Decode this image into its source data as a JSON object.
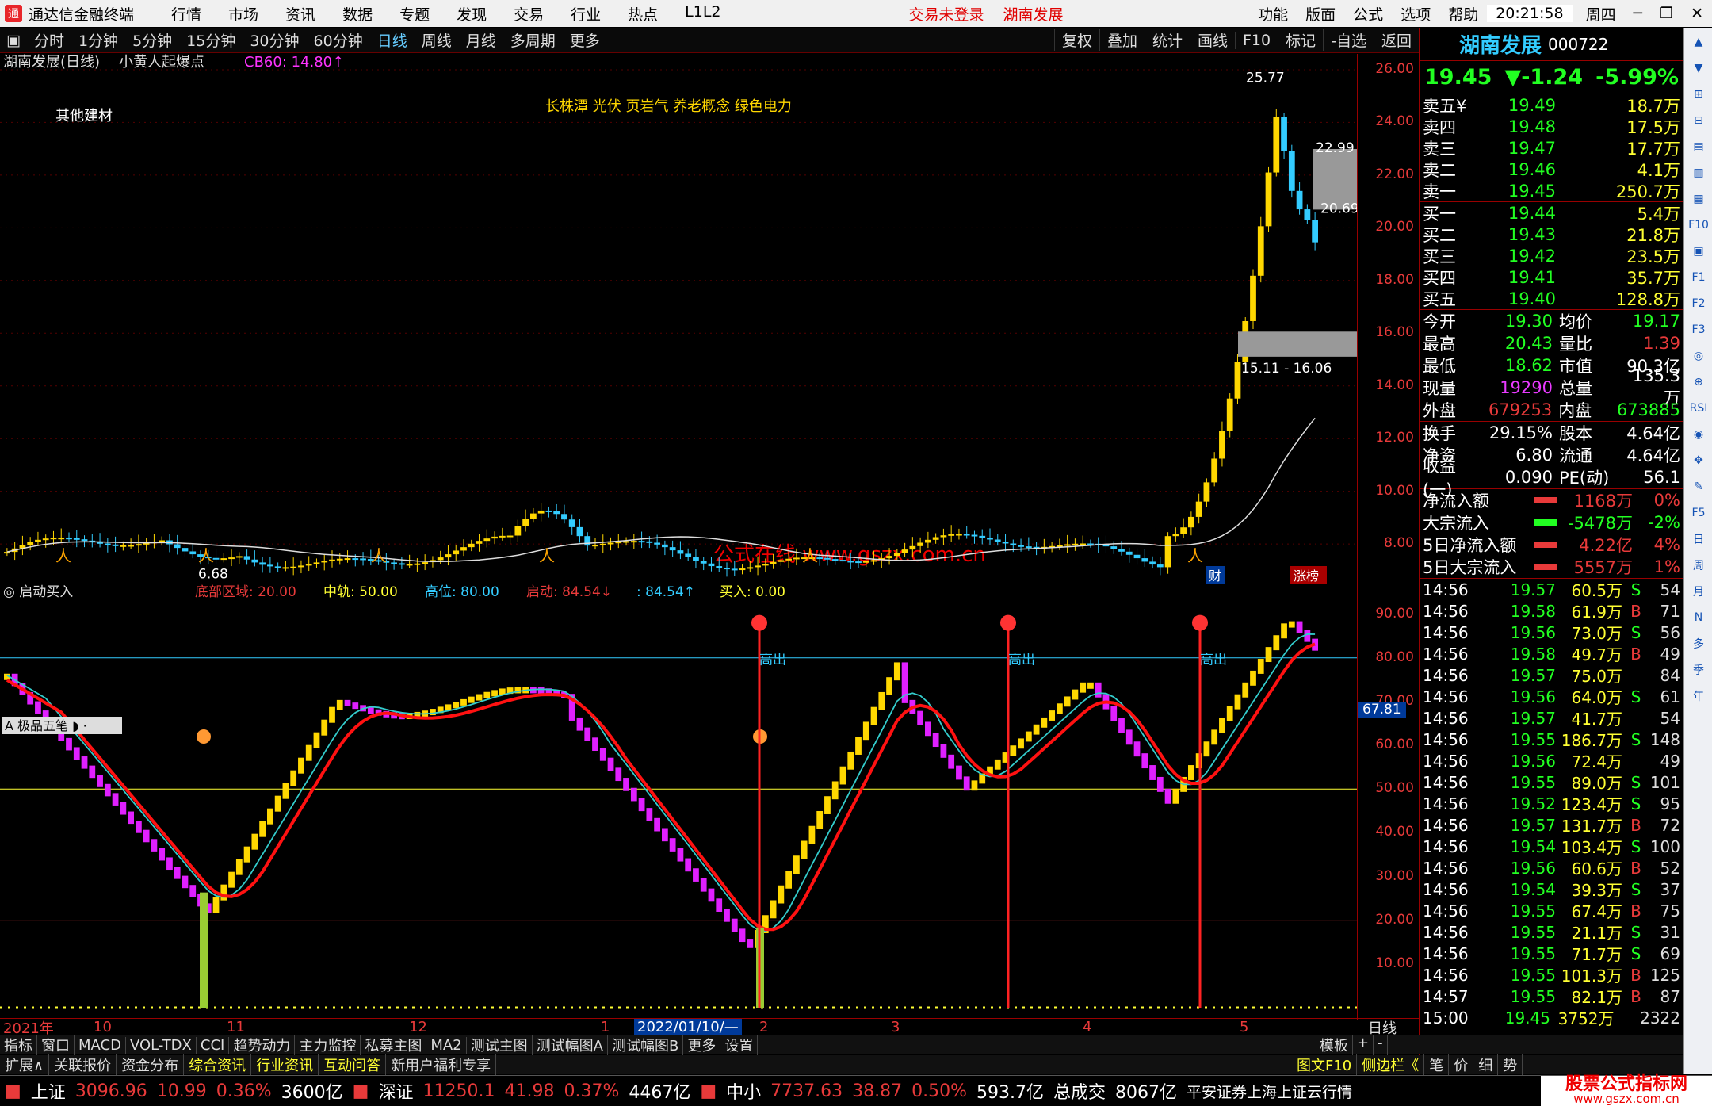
{
  "app": {
    "title": "通达信金融终端",
    "trade_status": "交易未登录",
    "stock_title": "湖南发展",
    "clock": "20:21:58",
    "weekday": "周四"
  },
  "menu": [
    "行情",
    "市场",
    "资讯",
    "数据",
    "专题",
    "发现",
    "交易",
    "行业",
    "热点",
    "L1L2"
  ],
  "menu_right": [
    "功能",
    "版面",
    "公式",
    "选项",
    "帮助"
  ],
  "periods": [
    "分时",
    "1分钟",
    "5分钟",
    "15分钟",
    "30分钟",
    "60分钟",
    "日线",
    "周线",
    "月线",
    "多周期",
    "更多"
  ],
  "active_period": "日线",
  "toolbar_right": [
    "复权",
    "叠加",
    "统计",
    "画线",
    "F10",
    "标记",
    "-自选",
    "返回"
  ],
  "price_header": {
    "name": "湖南发展(日线)",
    "formula": "小黄人起爆点",
    "cb": "CB60: 14.80↑"
  },
  "sector": "其他建材",
  "concepts": "长株潭 光伏 页岩气 养老概念 绿色电力",
  "watermark": "公式在线  www.gszx.com.cn",
  "price_ticks": [
    "26.00",
    "24.00",
    "22.00",
    "20.00",
    "18.00",
    "16.00",
    "14.00",
    "12.00",
    "10.00",
    "8.00"
  ],
  "price_labels": {
    "high": "25.77",
    "p1": "22.99",
    "p2": "20.69",
    "gap": "15.11 - 16.06",
    "low": "6.68"
  },
  "badges": [
    "财",
    "涨榜"
  ],
  "ind_header": {
    "name": "启动买入",
    "items": [
      {
        "k": "底部区域:",
        "v": "20.00",
        "c": "#e83a3a"
      },
      {
        "k": "中轨:",
        "v": "50.00",
        "c": "#ff3"
      },
      {
        "k": "高位:",
        "v": "80.00",
        "c": "#3cf"
      },
      {
        "k": "启动:",
        "v": "84.54↓",
        "c": "#e83a3a"
      },
      {
        "k": ":",
        "v": "84.54↑",
        "c": "#3cf"
      },
      {
        "k": "买入:",
        "v": "0.00",
        "c": "#ff3"
      }
    ]
  },
  "ind_ticks": [
    "90.00",
    "80.00",
    "70.00",
    "60.00",
    "50.00",
    "40.00",
    "30.00",
    "20.00",
    "10.00"
  ],
  "ind_value": "67.81",
  "gaochu": "高出",
  "tool_label": "极品五笔",
  "date_axis": [
    {
      "t": "2021年"
    },
    {
      "t": "10"
    },
    {
      "t": "11"
    },
    {
      "t": "12"
    },
    {
      "t": "1"
    },
    {
      "t": "2022/01/10/—",
      "hl": true
    },
    {
      "t": "2"
    },
    {
      "t": "3"
    },
    {
      "t": "4"
    },
    {
      "t": "5"
    }
  ],
  "date_axis_right": "日线",
  "quote": {
    "name": "湖南发展",
    "code": "000722",
    "price": "19.45",
    "change": "▼-1.24",
    "pct": "-5.99%",
    "asks": [
      {
        "l": "卖五¥",
        "p": "19.49",
        "v": "18.7万"
      },
      {
        "l": "卖四",
        "p": "19.48",
        "v": "17.5万"
      },
      {
        "l": "卖三",
        "p": "19.47",
        "v": "17.7万"
      },
      {
        "l": "卖二",
        "p": "19.46",
        "v": "4.1万"
      },
      {
        "l": "卖一",
        "p": "19.45",
        "v": "250.7万"
      }
    ],
    "bids": [
      {
        "l": "买一",
        "p": "19.44",
        "v": "5.4万"
      },
      {
        "l": "买二",
        "p": "19.43",
        "v": "21.8万"
      },
      {
        "l": "买三",
        "p": "19.42",
        "v": "23.5万"
      },
      {
        "l": "买四",
        "p": "19.41",
        "v": "35.7万"
      },
      {
        "l": "买五",
        "p": "19.40",
        "v": "128.8万"
      }
    ],
    "stats": [
      {
        "k1": "今开",
        "v1": "19.30",
        "c1": "#2f2",
        "k2": "均价",
        "v2": "19.17",
        "c2": "#2f2"
      },
      {
        "k1": "最高",
        "v1": "20.43",
        "c1": "#2f2",
        "k2": "量比",
        "v2": "1.39",
        "c2": "#e83a3a"
      },
      {
        "k1": "最低",
        "v1": "18.62",
        "c1": "#2f2",
        "k2": "市值",
        "v2": "90.3亿",
        "c2": "#fff"
      },
      {
        "k1": "现量",
        "v1": "19290",
        "c1": "#e83aff",
        "k2": "总量",
        "v2": "135.3万",
        "c2": "#fff"
      },
      {
        "k1": "外盘",
        "v1": "679253",
        "c1": "#e83a3a",
        "k2": "内盘",
        "v2": "673885",
        "c2": "#2f2"
      }
    ],
    "stats2": [
      {
        "k1": "换手",
        "v1": "29.15%",
        "c1": "#fff",
        "k2": "股本",
        "v2": "4.64亿",
        "c2": "#fff"
      },
      {
        "k1": "净资",
        "v1": "6.80",
        "c1": "#fff",
        "k2": "流通",
        "v2": "4.64亿",
        "c2": "#fff"
      },
      {
        "k1": "收益(一)",
        "v1": "0.090",
        "c1": "#fff",
        "k2": "PE(动)",
        "v2": "56.1",
        "c2": "#fff"
      }
    ],
    "flows": [
      {
        "k": "净流入额",
        "v": "1168万",
        "p": "0%",
        "c": "#e83a3a"
      },
      {
        "k": "大宗流入",
        "v": "-5478万",
        "p": "-2%",
        "c": "#2f2"
      },
      {
        "k": "5日净流入额",
        "v": "4.22亿",
        "p": "4%",
        "c": "#e83a3a"
      },
      {
        "k": "5日大宗流入",
        "v": "5557万",
        "p": "1%",
        "c": "#e83a3a"
      }
    ],
    "ticks": [
      {
        "t": "14:56",
        "p": "19.57",
        "v": "60.5万",
        "s": "S",
        "n": "54"
      },
      {
        "t": "14:56",
        "p": "19.58",
        "v": "61.9万",
        "s": "B",
        "n": "71"
      },
      {
        "t": "14:56",
        "p": "19.56",
        "v": "73.0万",
        "s": "S",
        "n": "56"
      },
      {
        "t": "14:56",
        "p": "19.58",
        "v": "49.7万",
        "s": "B",
        "n": "49"
      },
      {
        "t": "14:56",
        "p": "19.57",
        "v": "75.0万",
        "s": "",
        "n": "84"
      },
      {
        "t": "14:56",
        "p": "19.56",
        "v": "64.0万",
        "s": "S",
        "n": "61"
      },
      {
        "t": "14:56",
        "p": "19.57",
        "v": "41.7万",
        "s": "",
        "n": "54"
      },
      {
        "t": "14:56",
        "p": "19.55",
        "v": "186.7万",
        "s": "S",
        "n": "148"
      },
      {
        "t": "14:56",
        "p": "19.56",
        "v": "72.4万",
        "s": "",
        "n": "49"
      },
      {
        "t": "14:56",
        "p": "19.55",
        "v": "89.0万",
        "s": "S",
        "n": "101"
      },
      {
        "t": "14:56",
        "p": "19.52",
        "v": "123.4万",
        "s": "S",
        "n": "95"
      },
      {
        "t": "14:56",
        "p": "19.57",
        "v": "131.7万",
        "s": "B",
        "n": "72"
      },
      {
        "t": "14:56",
        "p": "19.54",
        "v": "103.4万",
        "s": "S",
        "n": "100"
      },
      {
        "t": "14:56",
        "p": "19.56",
        "v": "60.6万",
        "s": "B",
        "n": "52"
      },
      {
        "t": "14:56",
        "p": "19.54",
        "v": "39.3万",
        "s": "S",
        "n": "37"
      },
      {
        "t": "14:56",
        "p": "19.55",
        "v": "67.4万",
        "s": "B",
        "n": "75"
      },
      {
        "t": "14:56",
        "p": "19.55",
        "v": "21.1万",
        "s": "S",
        "n": "31"
      },
      {
        "t": "14:56",
        "p": "19.55",
        "v": "71.7万",
        "s": "S",
        "n": "69"
      },
      {
        "t": "14:56",
        "p": "19.55",
        "v": "101.3万",
        "s": "B",
        "n": "125"
      },
      {
        "t": "14:57",
        "p": "19.55",
        "v": "82.1万",
        "s": "B",
        "n": "87"
      },
      {
        "t": "15:00",
        "p": "19.45",
        "v": "3752万",
        "s": "",
        "n": "2322"
      }
    ]
  },
  "tabs1": [
    "指标",
    "窗口",
    "MACD",
    "VOL-TDX",
    "CCI",
    "趋势动力",
    "主力监控",
    "私募主图",
    "MA2",
    "测试主图",
    "测试幅图A",
    "测试幅图B",
    "更多",
    "设置"
  ],
  "tabs1_right": [
    "模板",
    "+",
    "-"
  ],
  "tabs2": [
    "扩展∧",
    "关联报价",
    "资金分布",
    "综合资讯",
    "行业资讯",
    "互动问答",
    "新用户福利专享"
  ],
  "tabs2_right": [
    "图文F10",
    "侧边栏《",
    "笔",
    "价",
    "细",
    "势"
  ],
  "status": {
    "sh": {
      "name": "上证",
      "v": "3096.96",
      "c": "10.99",
      "p": "0.36%",
      "a": "3600亿"
    },
    "sz": {
      "name": "深证",
      "v": "11250.1",
      "c": "41.98",
      "p": "0.37%",
      "a": "4467亿"
    },
    "zx": {
      "name": "中小",
      "v": "7737.63",
      "c": "38.87",
      "p": "0.50%",
      "a": "593.7亿"
    },
    "total_label": "总成交",
    "total": "8067亿",
    "broker": "平安证券上海上证云行情",
    "logo": "股票公式指标网",
    "logo_url": "www.gszx.com.cn"
  },
  "vtools": [
    "▲",
    "▼",
    "⊞",
    "⊟",
    "▤",
    "▥",
    "▦",
    "F10",
    "▣",
    "F1",
    "F2",
    "F3",
    "◎",
    "⊕",
    "RSI",
    "◉",
    "✥",
    "✎",
    "F5",
    "日",
    "周",
    "月",
    "N",
    "多",
    "季",
    "年"
  ],
  "colors": {
    "up": "#ffd700",
    "down": "#e020ff",
    "rise": "#e83a3a",
    "fall": "#2f2",
    "cyan": "#3cf"
  }
}
